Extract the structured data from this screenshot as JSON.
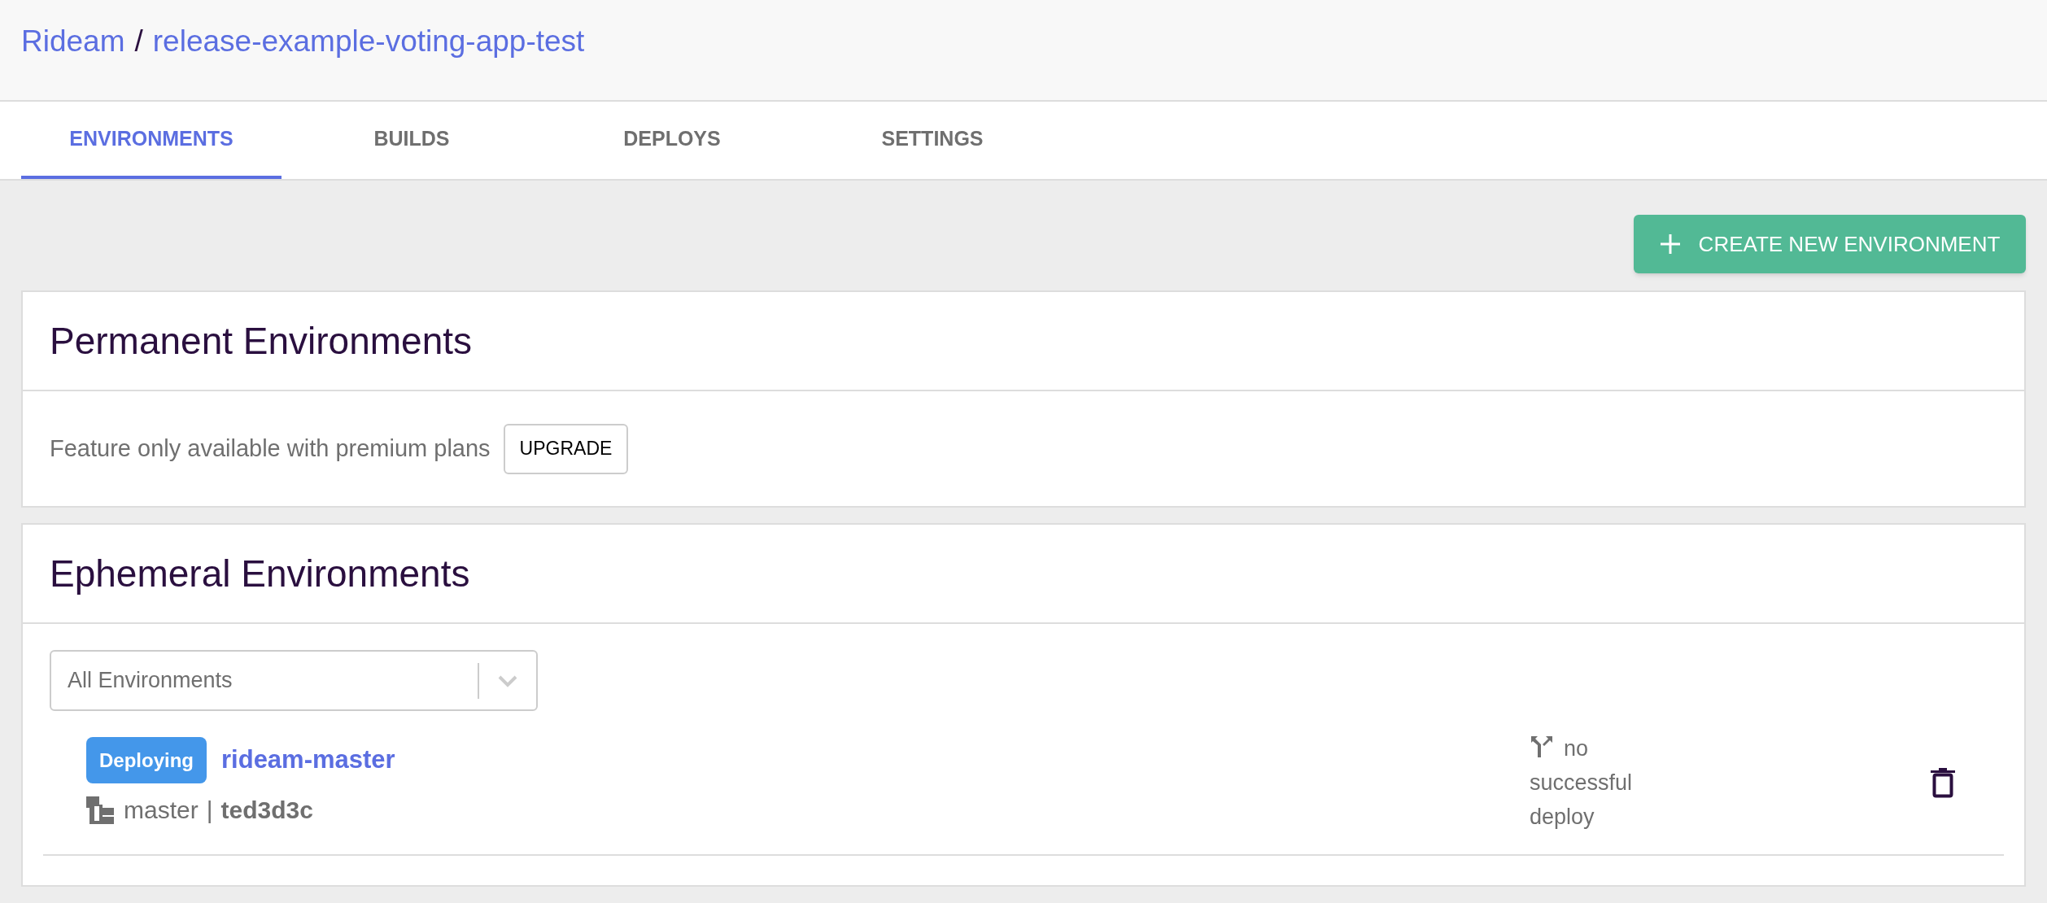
{
  "breadcrumb": {
    "organization": "Rideam",
    "separator": "/",
    "project": "release-example-voting-app-test"
  },
  "tabs": [
    {
      "label": "ENVIRONMENTS",
      "selected": true
    },
    {
      "label": "BUILDS",
      "selected": false
    },
    {
      "label": "DEPLOYS",
      "selected": false
    },
    {
      "label": "SETTINGS",
      "selected": false
    }
  ],
  "create_button": {
    "label": "CREATE NEW ENVIRONMENT"
  },
  "permanent": {
    "title": "Permanent Environments",
    "message": "Feature only available with premium plans",
    "button": "UPGRADE"
  },
  "ephemeral": {
    "title": "Ephemeral Environments",
    "filter": {
      "value": "All Environments"
    },
    "environments": [
      {
        "status": "Deploying",
        "name": "rideam-master",
        "branch": "master",
        "separator": "|",
        "commit": "ted3d3c",
        "deploy_status": "no successful deploy"
      }
    ]
  }
}
